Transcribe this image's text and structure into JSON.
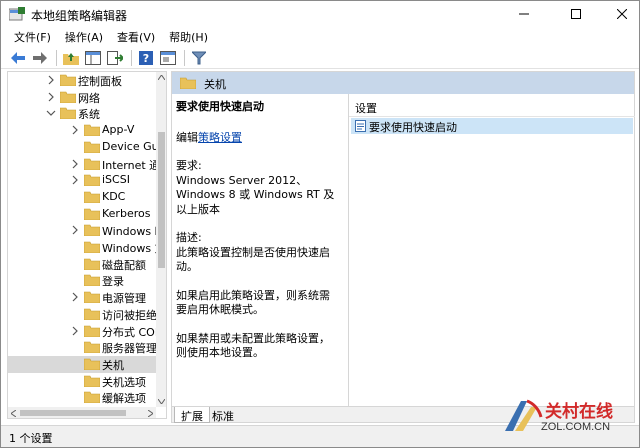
{
  "window": {
    "title": "本地组策略编辑器"
  },
  "menu": [
    "文件(F)",
    "操作(A)",
    "查看(V)",
    "帮助(H)"
  ],
  "toolbar": {
    "buttons": [
      "back-arrow-icon",
      "forward-arrow-icon",
      "up-folder-icon",
      "show-hide-tree-icon",
      "export-list-icon",
      "help-icon",
      "properties-icon",
      "filter-icon"
    ]
  },
  "tree": {
    "items": [
      {
        "label": "控制面板",
        "chevron": "right",
        "depth": 1
      },
      {
        "label": "网络",
        "chevron": "right",
        "depth": 1
      },
      {
        "label": "系统",
        "chevron": "down",
        "depth": 1
      },
      {
        "label": "App-V",
        "chevron": "right",
        "depth": 2
      },
      {
        "label": "Device Guard",
        "chevron": "",
        "depth": 2
      },
      {
        "label": "Internet 通信",
        "chevron": "right",
        "depth": 2
      },
      {
        "label": "iSCSI",
        "chevron": "right",
        "depth": 2
      },
      {
        "label": "KDC",
        "chevron": "",
        "depth": 2
      },
      {
        "label": "Kerberos",
        "chevron": "",
        "depth": 2
      },
      {
        "label": "Windows 时间",
        "chevron": "right",
        "depth": 2
      },
      {
        "label": "Windows 文件",
        "chevron": "",
        "depth": 2
      },
      {
        "label": "磁盘配额",
        "chevron": "",
        "depth": 2
      },
      {
        "label": "登录",
        "chevron": "",
        "depth": 2
      },
      {
        "label": "电源管理",
        "chevron": "right",
        "depth": 2
      },
      {
        "label": "访问被拒绝协",
        "chevron": "",
        "depth": 2
      },
      {
        "label": "分布式 COM",
        "chevron": "right",
        "depth": 2
      },
      {
        "label": "服务器管理器",
        "chevron": "",
        "depth": 2
      },
      {
        "label": "关机",
        "chevron": "",
        "depth": 2,
        "selected": true
      },
      {
        "label": "关机选项",
        "chevron": "",
        "depth": 2
      },
      {
        "label": "缓解选项",
        "chevron": "",
        "depth": 2
      }
    ]
  },
  "right_pane": {
    "header": "关机",
    "policy_title": "要求使用快速启动",
    "edit_prefix": "编辑",
    "edit_link": "策略设置",
    "requirements_label": "要求:",
    "requirements_text": "Windows Server 2012、Windows 8 或 Windows RT 及以上版本",
    "description_label": "描述:",
    "description_text": "此策略设置控制是否使用快速启动。",
    "enabled_text": "如果启用此策略设置，则系统需要启用休眠模式。",
    "disabled_text": "如果禁用或未配置此策略设置，则使用本地设置。",
    "settings_column": "设置",
    "settings_rows": [
      "要求使用快速启动"
    ],
    "tabs": [
      "扩展",
      "标准"
    ]
  },
  "status": {
    "text": "1 个设置"
  },
  "watermark": {
    "cn": "关村在线",
    "en": "ZOL.COM.CN"
  },
  "colors": {
    "header_bg": "#c7d7ea",
    "selected_row": "#cce4f7",
    "link": "#0645ad",
    "folder": "#e8c15a"
  }
}
